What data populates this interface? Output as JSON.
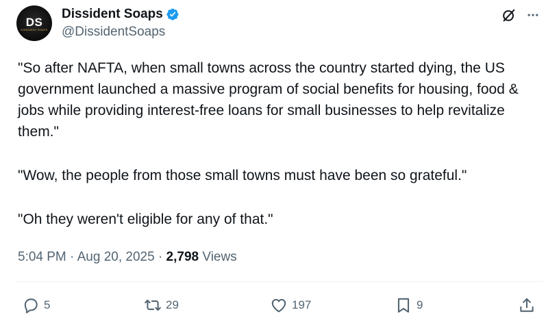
{
  "author": {
    "display_name": "Dissident Soaps",
    "handle": "@DissidentSoaps",
    "avatar_monogram": "DS",
    "avatar_subtitle": "DISSIDENT SOAPS",
    "verified": true,
    "verified_color": "#1d9bf0"
  },
  "tweet": {
    "paragraphs": [
      "\"So after NAFTA, when small towns across the country started dying, the US government launched a massive program of social benefits for housing, food & jobs while providing interest-free loans for small businesses to help revitalize them.\"",
      "\"Wow, the people from those small towns must have been so grateful.\"",
      "\"Oh they weren't eligible for any of that.\""
    ],
    "time": "5:04 PM",
    "separator": "·",
    "date": "Aug 20, 2025",
    "views_count": "2,798",
    "views_label": "Views"
  },
  "actions": {
    "reply_count": "5",
    "repost_count": "29",
    "like_count": "197",
    "bookmark_count": "9"
  },
  "icons": {
    "grok": "grok-icon",
    "more": "more-icon",
    "reply": "reply-icon",
    "repost": "repost-icon",
    "like": "heart-icon",
    "bookmark": "bookmark-icon",
    "share": "share-icon"
  },
  "colors": {
    "text_primary": "#0f1419",
    "text_secondary": "#536471",
    "divider": "#eff3f4",
    "verified": "#1d9bf0"
  }
}
